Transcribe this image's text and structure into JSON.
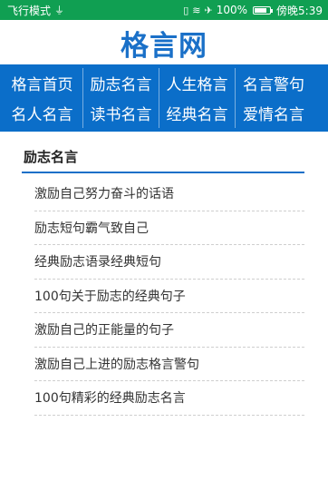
{
  "status_bar": {
    "left_text": "飞行模式",
    "right_battery": "100%",
    "right_time": "傍晚5:39"
  },
  "header": {
    "logo": "格言网"
  },
  "nav": [
    {
      "label": "格言首页"
    },
    {
      "label": "励志名言"
    },
    {
      "label": "人生格言"
    },
    {
      "label": "名言警句"
    },
    {
      "label": "名人名言"
    },
    {
      "label": "读书名言"
    },
    {
      "label": "经典名言"
    },
    {
      "label": "爱情名言"
    }
  ],
  "section": {
    "title": "励志名言",
    "items": [
      "激励自己努力奋斗的话语",
      "励志短句霸气致自己",
      "经典励志语录经典短句",
      "100句关于励志的经典句子",
      "激励自己的正能量的句子",
      "激励自己上进的励志格言警句",
      "100句精彩的经典励志名言"
    ]
  }
}
